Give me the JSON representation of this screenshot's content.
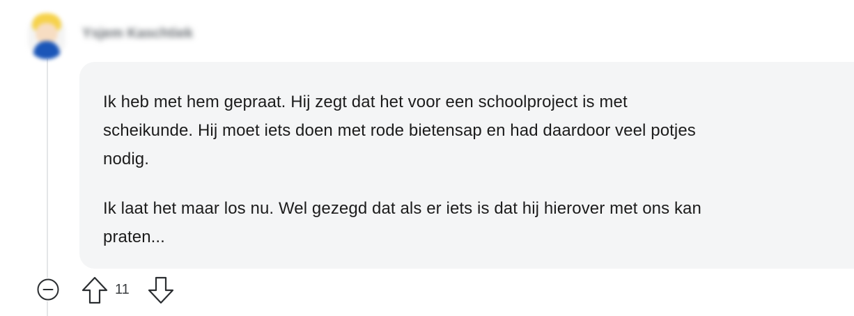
{
  "comment": {
    "author": "Ysjem Kaschtiek",
    "paragraphs": [
      "Ik heb met hem gepraat. Hij zegt dat het voor een schoolproject is met\nscheikunde. Hij moet iets doen met rode bietensap en had daardoor veel potjes\nnodig.",
      "Ik laat het maar los nu. Wel gezegd dat als er iets is dat hij hierover met ons kan\npraten..."
    ]
  },
  "actions": {
    "vote_count": "11",
    "collapse_icon": "minus-circle-icon",
    "upvote_icon": "arrow-up-outline-icon",
    "downvote_icon": "arrow-down-outline-icon"
  },
  "colors": {
    "bubble_background": "#f4f5f6",
    "thread_line": "#e4e6e8",
    "icon_stroke": "#2a2d30",
    "text": "#1c1c1c"
  }
}
